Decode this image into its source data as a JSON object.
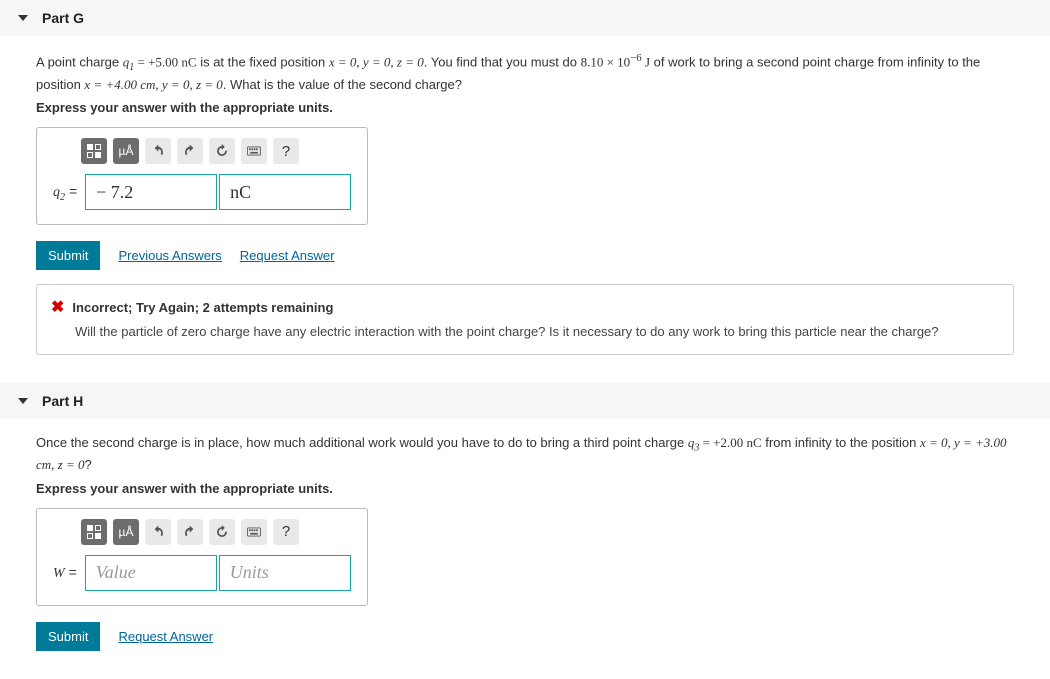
{
  "partG": {
    "title": "Part G",
    "prompt_pre": "A point charge ",
    "q1_label": "q",
    "q1_sub": "1",
    "q1_val": " = +5.00 nC",
    "prompt_mid1": " is at the fixed position ",
    "pos1": "x = 0, y = 0, z = 0",
    "prompt_mid2": ". You find that you must do ",
    "work": "8.10 × 10",
    "work_exp": "−6",
    "work_unit": " J",
    "prompt_mid3": " of work to bring a second point charge from infinity to the position ",
    "pos2": "x = +4.00 cm, y = 0, z = 0",
    "prompt_end": ". What is the value of the second charge?",
    "instr": "Express your answer with the appropriate units.",
    "toolbar": {
      "ua": "µÅ",
      "help": "?"
    },
    "ans_var": "q",
    "ans_sub": "2",
    "ans_eq": " =",
    "value": "− 7.2",
    "units": "nC",
    "submit": "Submit",
    "prev": "Previous Answers",
    "req": "Request Answer",
    "fb_title": "Incorrect; Try Again; 2 attempts remaining",
    "fb_msg": "Will the particle of zero charge have any electric interaction with the point charge? Is it necessary to do any work to bring this particle near the charge?"
  },
  "partH": {
    "title": "Part H",
    "prompt_pre": "Once the second charge is in place, how much additional work would you have to do to bring a third point charge ",
    "q3_label": "q",
    "q3_sub": "3",
    "q3_val": " = +2.00 nC",
    "prompt_mid": " from infinity to the position ",
    "pos": "x = 0, y = +3.00 cm, z = 0",
    "prompt_end": "?",
    "instr": "Express your answer with the appropriate units.",
    "toolbar": {
      "ua": "µÅ",
      "help": "?"
    },
    "ans_var": "W",
    "ans_eq": " =",
    "value_ph": "Value",
    "units_ph": "Units",
    "submit": "Submit",
    "req": "Request Answer"
  }
}
